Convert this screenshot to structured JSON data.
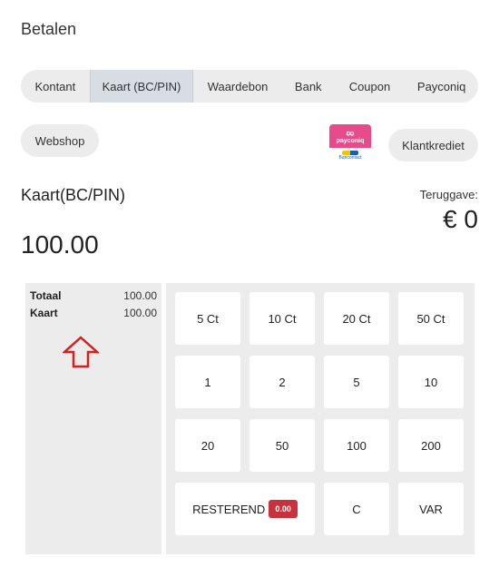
{
  "header": {
    "title": "Betalen"
  },
  "tabs": [
    {
      "label": "Kontant"
    },
    {
      "label": "Kaart (BC/PIN)",
      "active": true
    },
    {
      "label": "Waardebon"
    },
    {
      "label": "Bank"
    },
    {
      "label": "Coupon"
    },
    {
      "label": "Payconiq"
    }
  ],
  "buttons": {
    "webshop": "Webshop",
    "klantkrediet": "Klantkrediet"
  },
  "logo": {
    "name": "payconiq",
    "sub": "Bancontact"
  },
  "payment": {
    "method": "Kaart(BC/PIN)",
    "amount": "100.00",
    "change_label": "Teruggave:",
    "change_value": "€ 0"
  },
  "summary": {
    "rows": [
      {
        "label": "Totaal",
        "value": "100.00"
      },
      {
        "label": "Kaart",
        "value": "100.00"
      }
    ]
  },
  "keypad": {
    "keys": [
      "5 Ct",
      "10 Ct",
      "20 Ct",
      "50 Ct",
      "1",
      "2",
      "5",
      "10",
      "20",
      "50",
      "100",
      "200"
    ],
    "resterend_label": "RESTEREND",
    "resterend_value": "0.00",
    "clear": "C",
    "var": "VAR"
  },
  "colors": {
    "badge": "#c8323c",
    "arrow": "#d62020",
    "payconiq": "#e84b8a"
  }
}
